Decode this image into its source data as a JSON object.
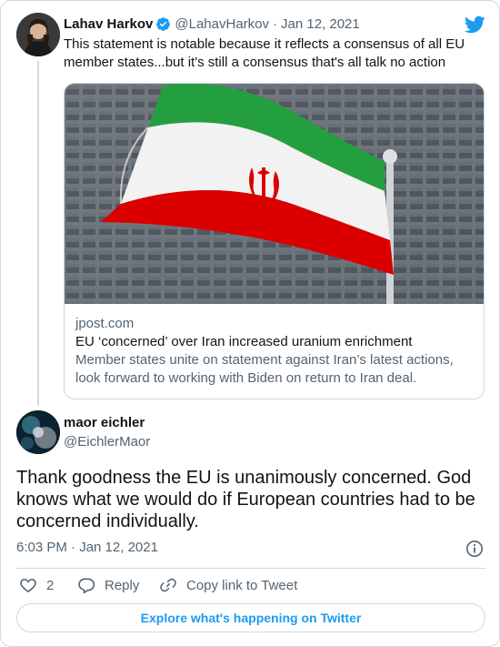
{
  "parent_tweet": {
    "author_name": "Lahav Harkov",
    "handle": "@LahavHarkov",
    "separator": "·",
    "date": "Jan 12, 2021",
    "text": "This statement is notable because it reflects a consensus of all EU member states...but it's still a consensus that's all talk no action",
    "link_card": {
      "domain": "jpost.com",
      "title": "EU ‘concerned’ over Iran increased uranium enrichment",
      "description": "Member states unite on statement against Iran’s latest actions, look forward to working with Biden on return to Iran deal."
    }
  },
  "tweet": {
    "author_name": "maor eichler",
    "handle": "@EichlerMaor",
    "text": "Thank goodness the EU is unanimously concerned. God knows what we would do if European countries had to be concerned individually.",
    "timestamp": "6:03 PM · Jan 12, 2021"
  },
  "actions": {
    "like_count": "2",
    "reply_label": "Reply",
    "copy_link_label": "Copy link to Tweet"
  },
  "explore_label": "Explore what's happening on Twitter",
  "colors": {
    "twitter_blue": "#1d9bf0",
    "text_primary": "#0f1419",
    "text_secondary": "#536471",
    "border": "#cfd9de"
  },
  "icons": [
    "verified-badge-icon",
    "twitter-bird-icon",
    "info-icon",
    "heart-icon",
    "reply-bubble-icon",
    "link-icon"
  ]
}
